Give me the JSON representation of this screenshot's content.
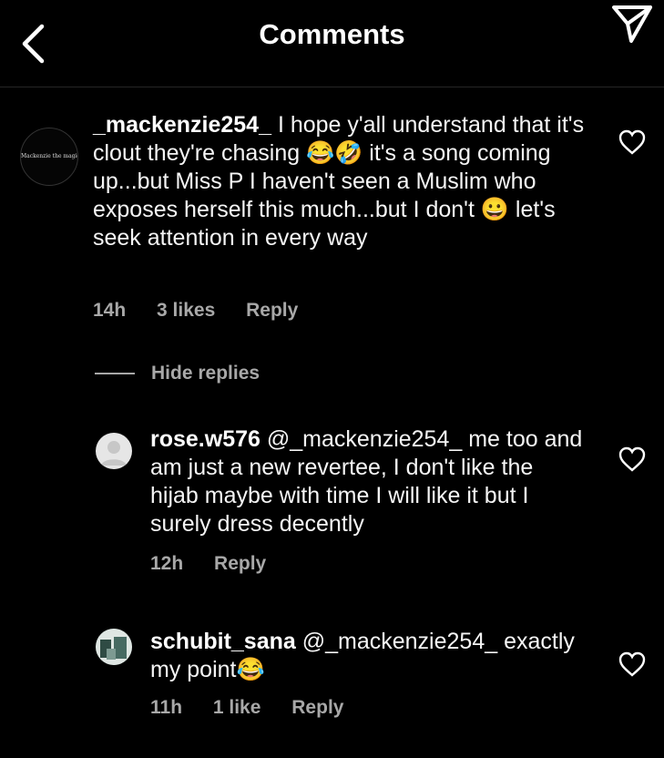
{
  "header": {
    "title": "Comments"
  },
  "comments": [
    {
      "username": "_mackenzie254_",
      "text": "I hope y'all understand that it's clout they're chasing 😂🤣 it's a song coming up...but Miss P I haven't seen a Muslim who exposes herself this much...but I don't 😀 let's seek attention in every way",
      "time": "14h",
      "likes": "3 likes",
      "reply_label": "Reply",
      "avatar_text": "Mackenzie the magic"
    }
  ],
  "hide_replies_label": "Hide replies",
  "replies": [
    {
      "username": "rose.w576",
      "text": "@_mackenzie254_ me too and am just a new revertee, I don't like the hijab maybe with time I will like it but I surely dress decently",
      "time": "12h",
      "reply_label": "Reply"
    },
    {
      "username": "schubit_sana",
      "text": "@_mackenzie254_ exactly my point😂",
      "time": "11h",
      "likes": "1 like",
      "reply_label": "Reply"
    }
  ],
  "colors": {
    "background": "#000000",
    "text": "#ffffff",
    "secondary": "#a8a8a8",
    "divider": "#262626"
  },
  "icons": [
    "back-icon",
    "send-icon",
    "heart-icon"
  ]
}
